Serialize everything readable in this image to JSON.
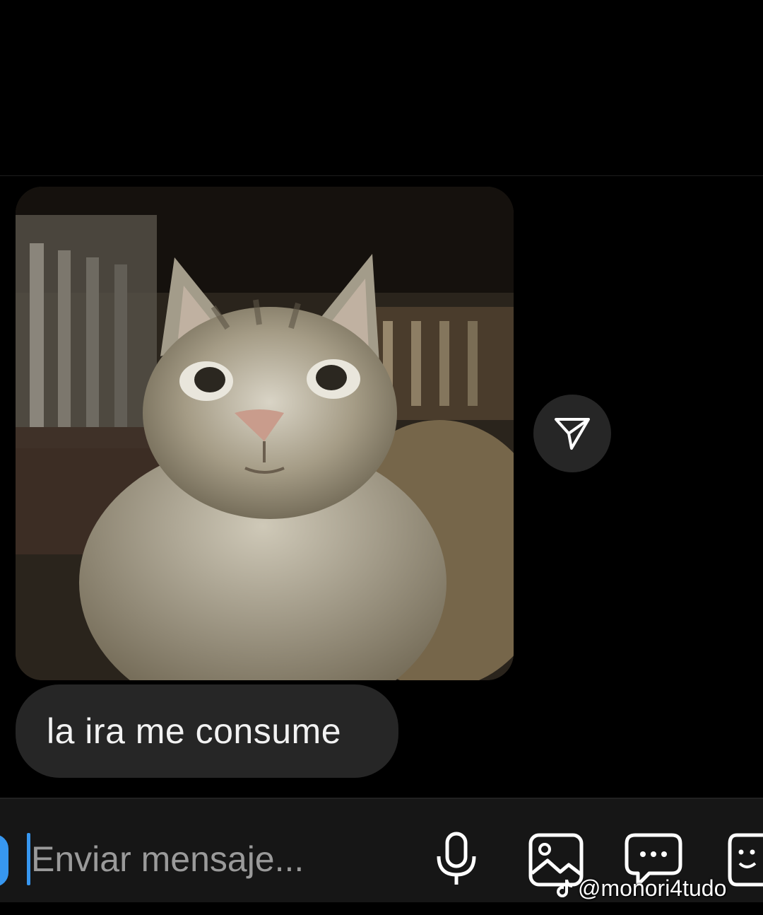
{
  "chat": {
    "message_text": "la ira me consume"
  },
  "composer": {
    "placeholder": "Enviar mensaje..."
  },
  "icons": [
    "send-icon",
    "microphone-icon",
    "gallery-icon",
    "chat-bubble-icon",
    "sticker-icon"
  ],
  "watermark": {
    "handle": "@monori4tudo"
  },
  "colors": {
    "background": "#000000",
    "bubble": "#262626",
    "accent": "#3797f0",
    "composer": "#161616"
  }
}
